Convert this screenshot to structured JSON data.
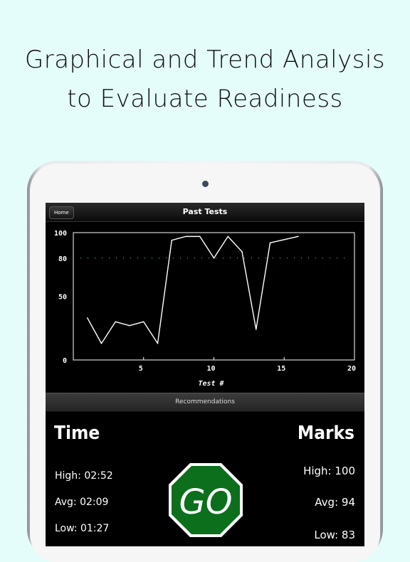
{
  "marketing": {
    "line1": "Graphical and Trend Analysis",
    "line2": "to Evaluate Readiness"
  },
  "navbar": {
    "home_label": "Home",
    "title": "Past Tests"
  },
  "chart_data": {
    "type": "line",
    "xlabel": "Test #",
    "ylabel": "",
    "xlim": [
      0,
      20
    ],
    "ylim": [
      0,
      100
    ],
    "xticks": [
      5,
      10,
      15,
      20
    ],
    "yticks": [
      0,
      50,
      80,
      100
    ],
    "reference_line": {
      "y": 80,
      "style": "dotted",
      "color": "#55ddcc"
    },
    "series": [
      {
        "x": [
          1,
          2,
          3,
          4,
          5,
          6,
          7,
          8,
          9,
          10,
          11,
          12,
          13,
          14,
          16
        ],
        "values": [
          33,
          13,
          30,
          27,
          30,
          13,
          94,
          97,
          97,
          80,
          97,
          85,
          24,
          92,
          97
        ],
        "color": "#ffffff"
      }
    ]
  },
  "recommendations": {
    "label": "Recommendations"
  },
  "time": {
    "title": "Time",
    "high": "High: 02:52",
    "avg": "Avg: 02:09",
    "low": "Low: 01:27"
  },
  "marks": {
    "title": "Marks",
    "high": "High: 100",
    "avg": "Avg: 94",
    "low": "Low: 83"
  },
  "status": {
    "label": "GO",
    "color": "#0b6f1c"
  }
}
